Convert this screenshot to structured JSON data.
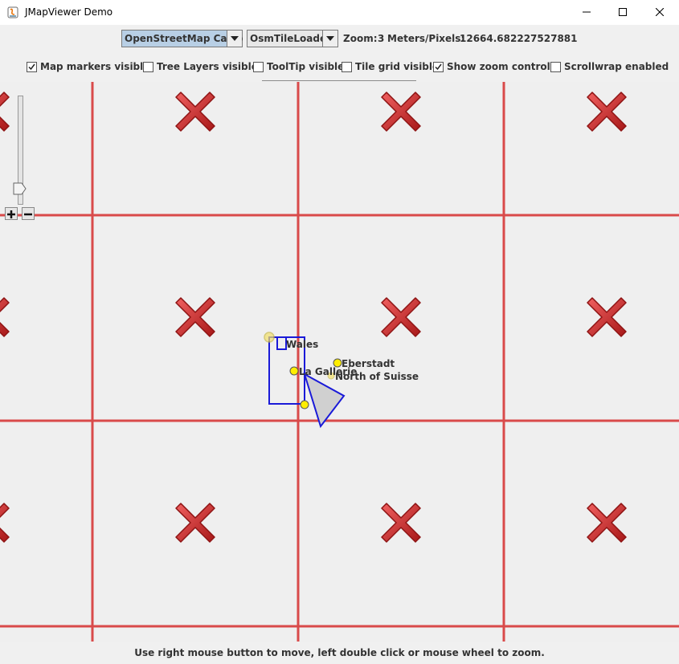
{
  "window": {
    "title": "JMapViewer Demo"
  },
  "toolbar": {
    "tile_source": "OpenStreetMap Carto",
    "tile_loader": "OsmTileLoader",
    "zoom_label": "Zoom:",
    "zoom_value": "3",
    "meters_label": "Meters/Pixels:",
    "meters_value": "12664.682227527881"
  },
  "checkboxes": [
    {
      "label": "Map markers visible",
      "checked": true
    },
    {
      "label": "Tree Layers visible",
      "checked": false
    },
    {
      "label": "ToolTip visible",
      "checked": false
    },
    {
      "label": "Tile grid visible",
      "checked": false
    },
    {
      "label": "Show zoom controls",
      "checked": true
    },
    {
      "label": "Scrollwrap enabled",
      "checked": false
    }
  ],
  "map": {
    "markers": [
      {
        "label": "Wales"
      },
      {
        "label": "La Gallerie"
      },
      {
        "label": "Eberstadt"
      },
      {
        "label": "North of Suisse"
      }
    ],
    "colors": {
      "grid": "#d94a4a",
      "polygon": "#1a1ad8",
      "marker": "#ffee00",
      "error_cross": "#c62828"
    },
    "tile_icon": "broken-tile-x-icon"
  },
  "status": {
    "hint": "Use right mouse button to move, left double click or mouse wheel to zoom."
  }
}
